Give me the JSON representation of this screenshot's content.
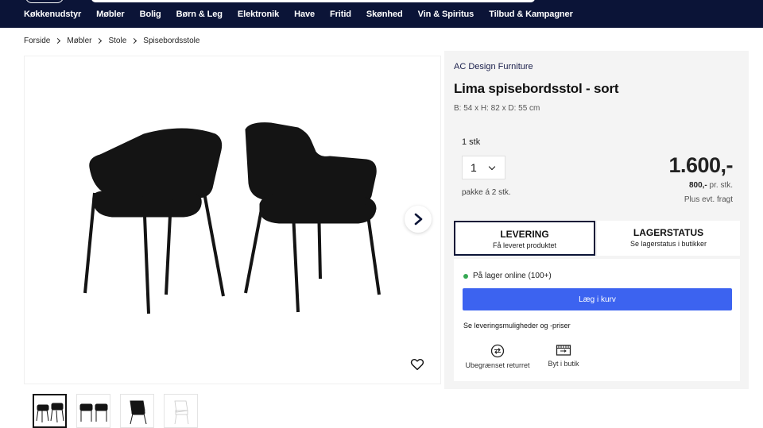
{
  "nav": {
    "items": [
      "Køkkenudstyr",
      "Møbler",
      "Bolig",
      "Børn & Leg",
      "Elektronik",
      "Have",
      "Fritid",
      "Skønhed",
      "Vin & Spiritus",
      "Tilbud & Kampagner"
    ]
  },
  "breadcrumb": [
    "Forside",
    "Møbler",
    "Stole",
    "Spisebordsstole"
  ],
  "product": {
    "brand": "AC Design Furniture",
    "title": "Lima spisebordsstol - sort",
    "dimensions": "B: 54 x H: 82 x D: 55 cm",
    "qty_label": "1 stk",
    "qty_value": "1",
    "pack_note": "pakke á 2 stk.",
    "price": "1.600,-",
    "unit_price_value": "800,-",
    "unit_price_suffix": " pr. stk.",
    "freight": "Plus evt. fragt"
  },
  "tabs": {
    "delivery": {
      "title": "LEVERING",
      "subtitle": "Få leveret produktet"
    },
    "stock": {
      "title": "LAGERSTATUS",
      "subtitle": "Se lagerstatus i butikker"
    }
  },
  "delivery": {
    "stock_status": "På lager online (100+)",
    "add_to_cart": "Læg i kurv",
    "options_link": "Se leveringsmuligheder og -priser",
    "feature_returns": "Ubegrænset returret",
    "feature_shop": "Byt i butik"
  },
  "colors": {
    "nav_bg": "#0b1437",
    "primary_button": "#3c63f0",
    "in_stock": "#35a853"
  },
  "icons": [
    "chevron-right-icon",
    "heart-icon",
    "returns-icon",
    "shop-icon",
    "chevron-down-icon"
  ]
}
